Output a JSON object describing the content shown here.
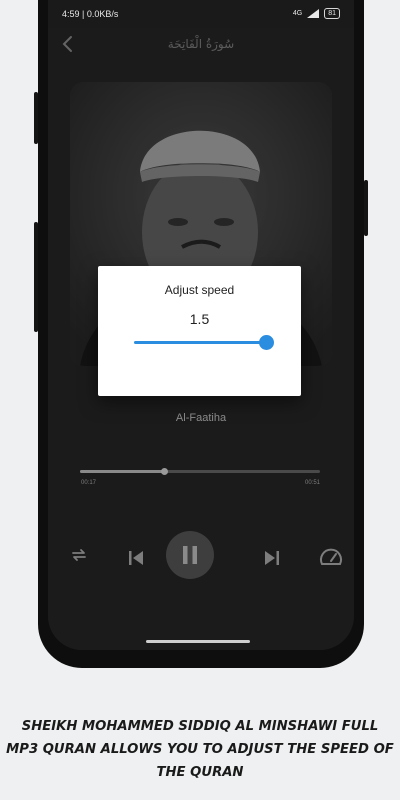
{
  "status_bar": {
    "time_speed": "4:59 | 0.0KB/s",
    "signal_label": "4G",
    "battery": "81"
  },
  "app_bar": {
    "title": "سُورَةُ الْفَاتِحَة",
    "back_icon": "chevron-left-icon"
  },
  "player": {
    "track_name": "Al-Faatiha",
    "elapsed": "00:17",
    "duration": "00:51",
    "progress_fraction": 0.35,
    "controls": [
      "repeat-icon",
      "skip-previous-icon",
      "pause-icon",
      "skip-next-icon",
      "speedometer-icon"
    ]
  },
  "speed_dialog": {
    "title": "Adjust speed",
    "value": "1.5",
    "level_fraction": 1.0,
    "accent_color": "#2b8de0"
  },
  "caption": {
    "lines": [
      "SHEIKH MOHAMMED SIDDIQ AL MINSHAWI FULL",
      "MP3 QURAN  ALLOWS YOU TO ADJUST THE SPEED OF",
      "THE QURAN"
    ]
  }
}
